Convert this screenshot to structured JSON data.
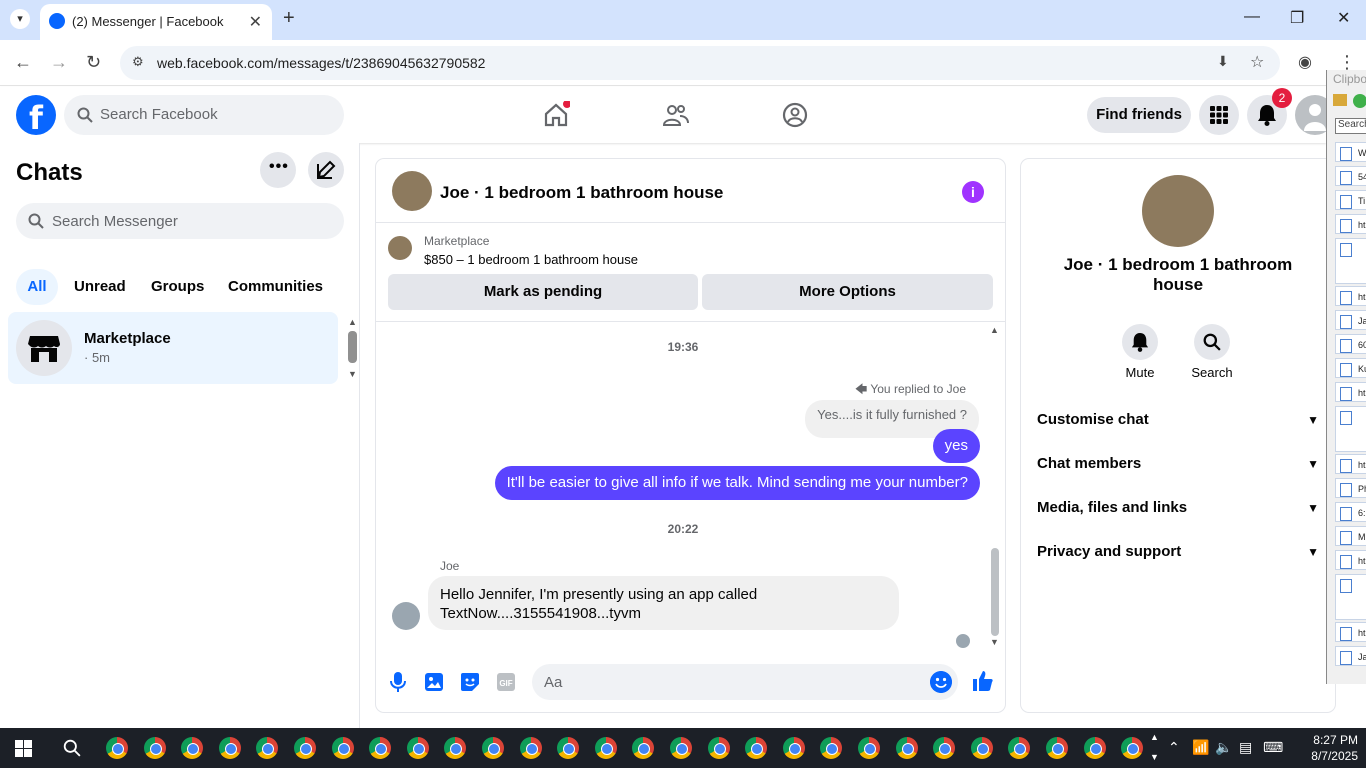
{
  "browser": {
    "tab_title": "(2) Messenger | Facebook",
    "url": "web.facebook.com/messages/t/23869045632790582"
  },
  "fb_header": {
    "search_placeholder": "Search Facebook",
    "find_friends": "Find friends",
    "notification_count": "2"
  },
  "chats": {
    "title": "Chats",
    "search_placeholder": "Search Messenger",
    "filters": [
      "All",
      "Unread",
      "Groups",
      "Communities"
    ],
    "active_filter": "All",
    "items": [
      {
        "name": "Marketplace",
        "time": "· 5m"
      }
    ]
  },
  "conversation": {
    "title": "Joe · 1 bedroom 1 bathroom house",
    "marketplace_label": "Marketplace",
    "listing": "$850 – 1 bedroom 1 bathroom house",
    "mark_pending": "Mark as pending",
    "more_options": "More Options",
    "timestamps": [
      "19:36",
      "20:22"
    ],
    "reply_note": "You replied to Joe",
    "quoted_text": "Yes....is it fully furnished ?",
    "my_messages": [
      "yes",
      "It'll be easier to give all info if we talk. Mind sending me your number?"
    ],
    "sender_name": "Joe",
    "incoming_message": "Hello Jennifer, I'm presently using an app called TextNow....3155541908...tyvm",
    "composer_placeholder": "Aa"
  },
  "info_panel": {
    "title": "Joe · 1 bedroom 1 bathroom house",
    "actions": [
      "Mute",
      "Search"
    ],
    "sections": [
      "Customise chat",
      "Chat members",
      "Media, files and links",
      "Privacy and support"
    ]
  },
  "clipboard": {
    "title": "Clipbo",
    "search_placeholder": "Search",
    "items": [
      "W",
      "54",
      "Ti",
      "ht",
      "",
      "ht",
      "Ja",
      "60",
      "Ku",
      "ht",
      "",
      "ht",
      "Ph",
      "6:",
      "M",
      "ht",
      "",
      "ht",
      "Ja"
    ]
  },
  "taskbar": {
    "time": "8:27 PM",
    "date": "8/7/2025"
  },
  "colors": {
    "fb_blue": "#0866ff",
    "bubble_purple": "#5b44ff",
    "notification_red": "#e41e3f"
  }
}
